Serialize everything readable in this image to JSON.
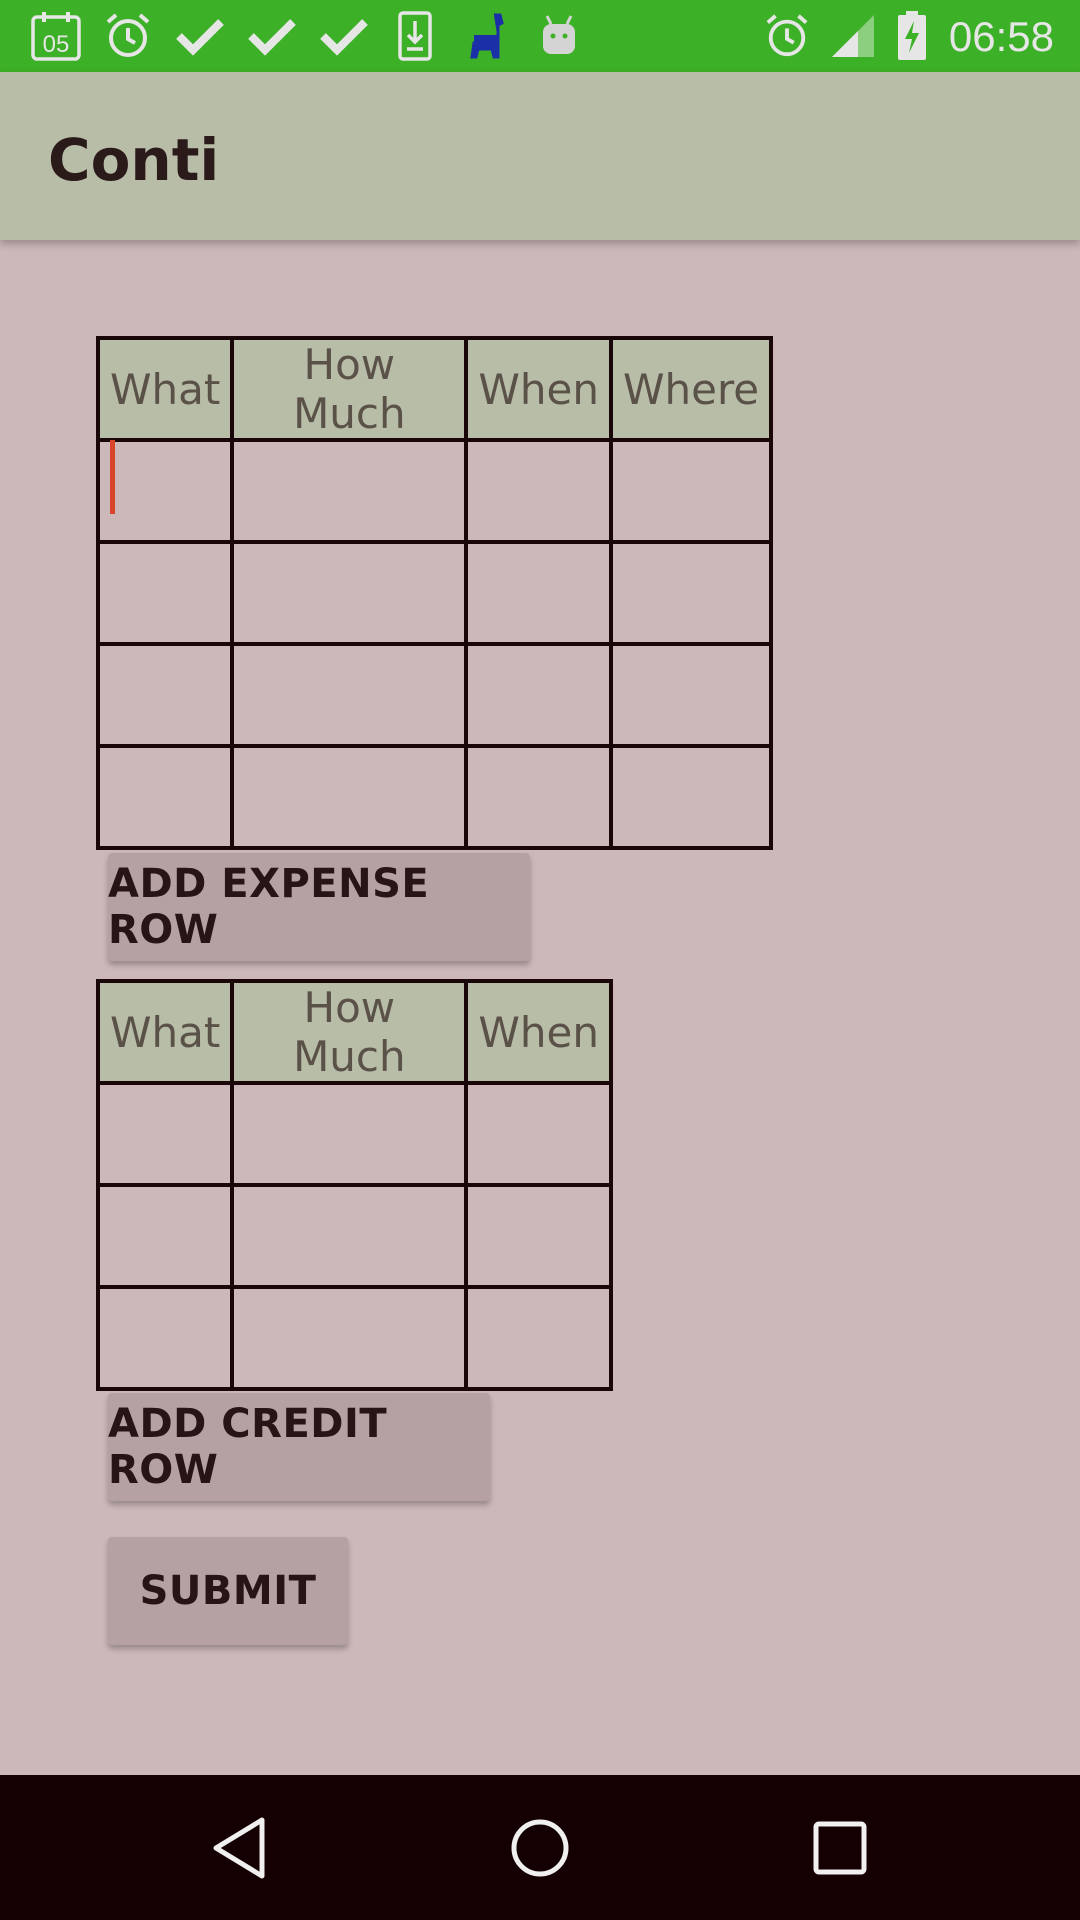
{
  "status_bar": {
    "calendar_day": "05",
    "time": "06:58",
    "icons": [
      "calendar-icon",
      "alarm-icon",
      "check-icon",
      "check-icon",
      "check-icon",
      "download-icon",
      "llama-icon",
      "android-icon",
      "alarm-icon",
      "signal-icon",
      "battery-charging-icon"
    ]
  },
  "app_bar": {
    "title": "Conti"
  },
  "expense_table": {
    "headers": [
      "What",
      "How Much",
      "When",
      "Where"
    ],
    "rows": [
      [
        "",
        "",
        "",
        ""
      ],
      [
        "",
        "",
        "",
        ""
      ],
      [
        "",
        "",
        "",
        ""
      ],
      [
        "",
        "",
        "",
        ""
      ]
    ]
  },
  "credit_table": {
    "headers": [
      "What",
      "How Much",
      "When"
    ],
    "rows": [
      [
        "",
        "",
        ""
      ],
      [
        "",
        "",
        ""
      ],
      [
        "",
        "",
        ""
      ]
    ]
  },
  "buttons": {
    "add_expense_row": "ADD EXPENSE ROW",
    "add_credit_row": "ADD CREDIT ROW",
    "submit": "SUBMIT"
  },
  "nav_bar": {
    "icons": [
      "back-icon",
      "home-icon",
      "recents-icon"
    ]
  },
  "colors": {
    "status_bar": "#3cb027",
    "app_bar": "#b8bda7",
    "background": "#cdb8b9",
    "button": "#b5a1a2",
    "cursor": "#d9442a"
  }
}
